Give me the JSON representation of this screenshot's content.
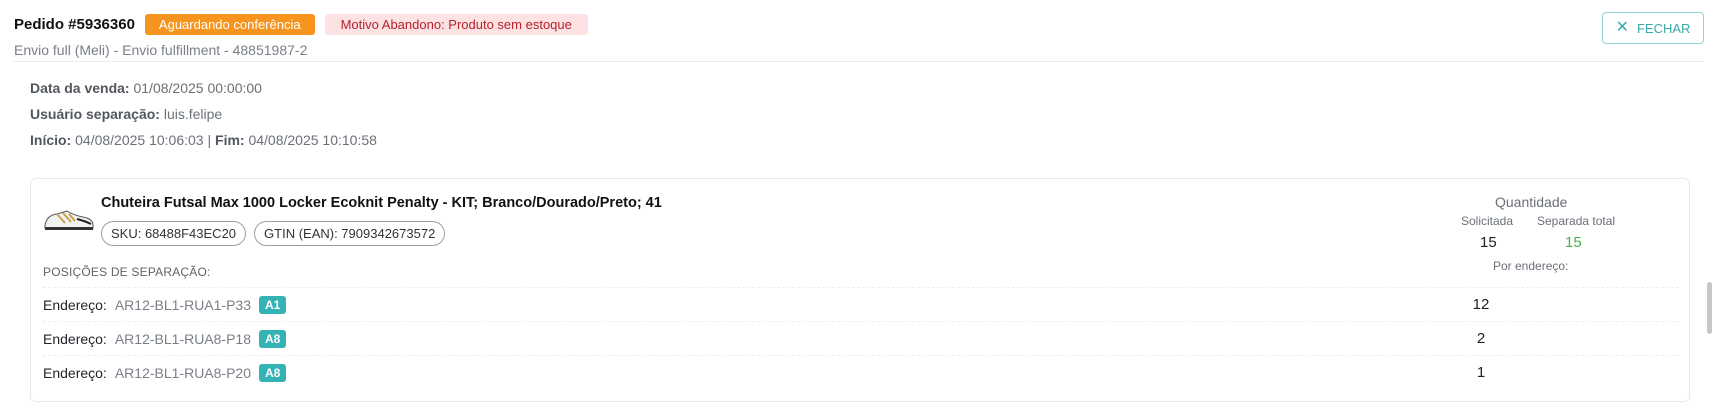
{
  "header": {
    "order_title": "Pedido #5936360",
    "status_badge": "Aguardando conferência",
    "reason_badge": "Motivo Abandono: Produto sem estoque",
    "subtitle": "Envio full (Meli) - Envio fulfillment - 48851987-2",
    "close_label": "FECHAR"
  },
  "meta": {
    "sale_date_label": "Data da venda:",
    "sale_date_value": "01/08/2025 00:00:00",
    "user_label": "Usuário separação:",
    "user_value": "luis.felipe",
    "start_label": "Início:",
    "start_value": "04/08/2025 10:06:03",
    "separator": "|",
    "end_label": "Fim:",
    "end_value": "04/08/2025 10:10:58"
  },
  "product": {
    "name": "Chuteira Futsal Max 1000 Locker Ecoknit Penalty - KIT; Branco/Dourado/Preto; 41",
    "sku": "SKU: 68488F43EC20",
    "gtin": "GTIN (EAN): 7909342673572",
    "positions_label": "POSIÇÕES DE SEPARAÇÃO:",
    "thumb_icon": "sneaker-icon",
    "quantity": {
      "title": "Quantidade",
      "requested_label": "Solicitada",
      "separated_label": "Separada total",
      "requested_value": "15",
      "separated_value": "15",
      "by_address_label": "Por endereço:"
    },
    "positions": [
      {
        "label": "Endereço:",
        "address": "AR12-BL1-RUA1-P33",
        "tag": "A1",
        "qty": "12"
      },
      {
        "label": "Endereço:",
        "address": "AR12-BL1-RUA8-P18",
        "tag": "A8",
        "qty": "2"
      },
      {
        "label": "Endereço:",
        "address": "AR12-BL1-RUA8-P20",
        "tag": "A8",
        "qty": "1"
      }
    ]
  },
  "colors": {
    "status_orange": "#f7941d",
    "reason_bg": "#fde2e4",
    "reason_text": "#b4232c",
    "teal": "#33b3b3",
    "green": "#4cae4c"
  }
}
